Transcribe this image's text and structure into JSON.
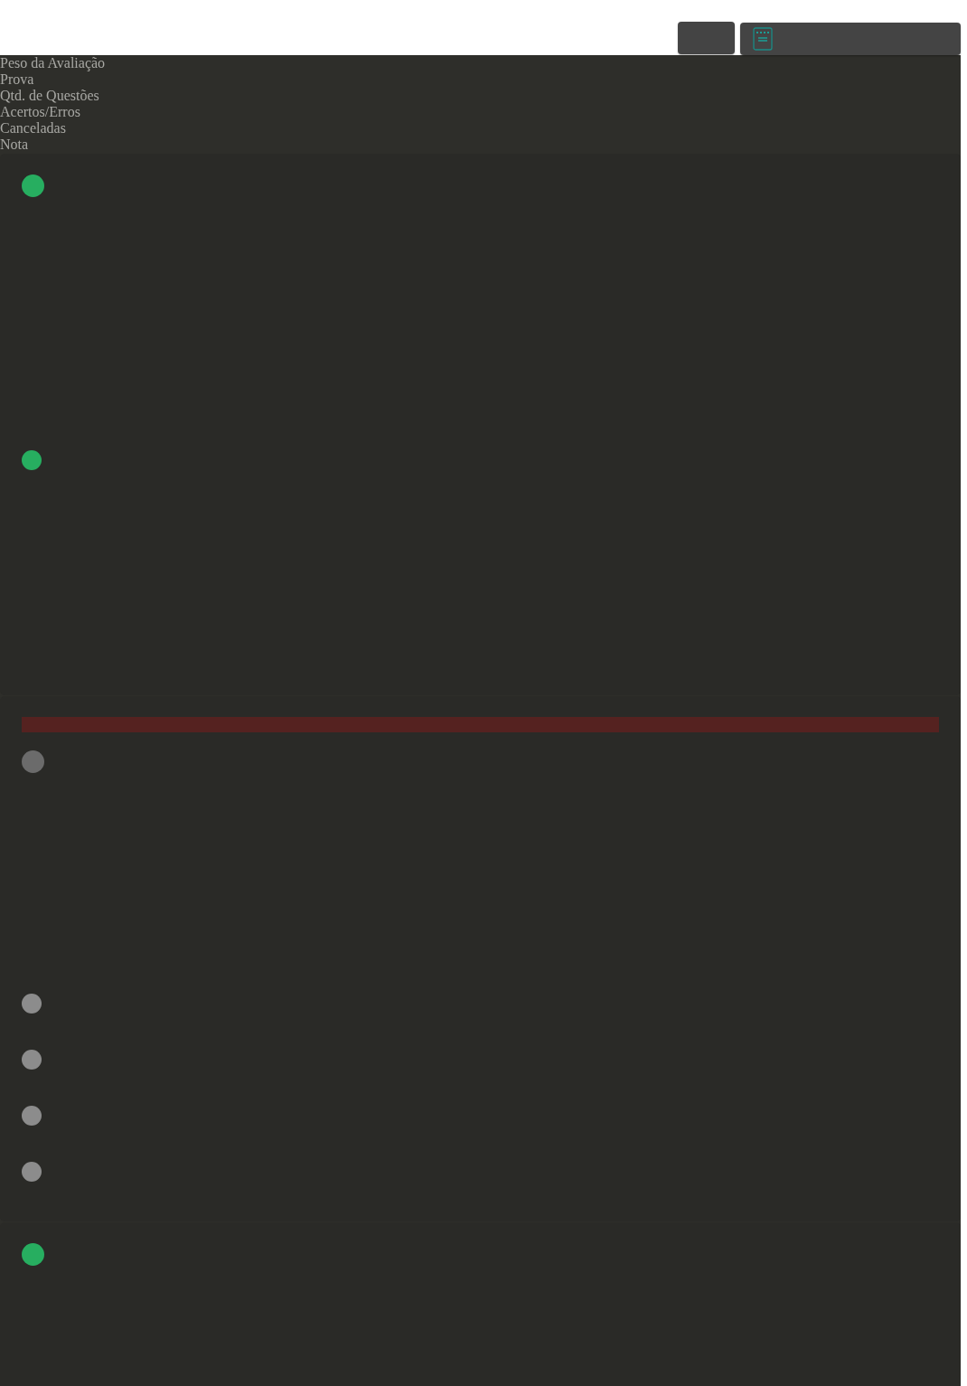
{
  "legend": [
    "Peso da Avaliação",
    "Prova",
    "Qtd. de Questões",
    "Acertos/Erros",
    "Canceladas",
    "Nota"
  ],
  "cards": [
    {
      "alert": false,
      "markers": [
        {
          "kind": "lead",
          "color": "#27ae60"
        },
        {
          "kind": "item",
          "color": "#27ae60"
        }
      ]
    },
    {
      "alert": true,
      "markers": [
        {
          "kind": "lead",
          "color": "#6b6b6b"
        },
        {
          "kind": "item",
          "color": "#8c8c8c"
        },
        {
          "kind": "item",
          "color": "#8c8c8c"
        },
        {
          "kind": "item",
          "color": "#8c8c8c"
        },
        {
          "kind": "item",
          "color": "#8c8c8c"
        }
      ]
    },
    {
      "alert": false,
      "markers": [
        {
          "kind": "lead",
          "color": "#27ae60"
        }
      ]
    }
  ]
}
